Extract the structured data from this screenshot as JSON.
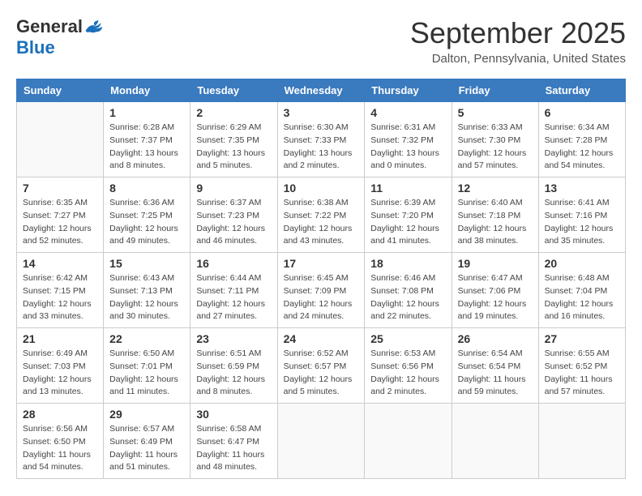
{
  "header": {
    "logo_general": "General",
    "logo_blue": "Blue",
    "month_title": "September 2025",
    "location": "Dalton, Pennsylvania, United States"
  },
  "weekdays": [
    "Sunday",
    "Monday",
    "Tuesday",
    "Wednesday",
    "Thursday",
    "Friday",
    "Saturday"
  ],
  "weeks": [
    [
      {
        "day": "",
        "info": ""
      },
      {
        "day": "1",
        "info": "Sunrise: 6:28 AM\nSunset: 7:37 PM\nDaylight: 13 hours\nand 8 minutes."
      },
      {
        "day": "2",
        "info": "Sunrise: 6:29 AM\nSunset: 7:35 PM\nDaylight: 13 hours\nand 5 minutes."
      },
      {
        "day": "3",
        "info": "Sunrise: 6:30 AM\nSunset: 7:33 PM\nDaylight: 13 hours\nand 2 minutes."
      },
      {
        "day": "4",
        "info": "Sunrise: 6:31 AM\nSunset: 7:32 PM\nDaylight: 13 hours\nand 0 minutes."
      },
      {
        "day": "5",
        "info": "Sunrise: 6:33 AM\nSunset: 7:30 PM\nDaylight: 12 hours\nand 57 minutes."
      },
      {
        "day": "6",
        "info": "Sunrise: 6:34 AM\nSunset: 7:28 PM\nDaylight: 12 hours\nand 54 minutes."
      }
    ],
    [
      {
        "day": "7",
        "info": "Sunrise: 6:35 AM\nSunset: 7:27 PM\nDaylight: 12 hours\nand 52 minutes."
      },
      {
        "day": "8",
        "info": "Sunrise: 6:36 AM\nSunset: 7:25 PM\nDaylight: 12 hours\nand 49 minutes."
      },
      {
        "day": "9",
        "info": "Sunrise: 6:37 AM\nSunset: 7:23 PM\nDaylight: 12 hours\nand 46 minutes."
      },
      {
        "day": "10",
        "info": "Sunrise: 6:38 AM\nSunset: 7:22 PM\nDaylight: 12 hours\nand 43 minutes."
      },
      {
        "day": "11",
        "info": "Sunrise: 6:39 AM\nSunset: 7:20 PM\nDaylight: 12 hours\nand 41 minutes."
      },
      {
        "day": "12",
        "info": "Sunrise: 6:40 AM\nSunset: 7:18 PM\nDaylight: 12 hours\nand 38 minutes."
      },
      {
        "day": "13",
        "info": "Sunrise: 6:41 AM\nSunset: 7:16 PM\nDaylight: 12 hours\nand 35 minutes."
      }
    ],
    [
      {
        "day": "14",
        "info": "Sunrise: 6:42 AM\nSunset: 7:15 PM\nDaylight: 12 hours\nand 33 minutes."
      },
      {
        "day": "15",
        "info": "Sunrise: 6:43 AM\nSunset: 7:13 PM\nDaylight: 12 hours\nand 30 minutes."
      },
      {
        "day": "16",
        "info": "Sunrise: 6:44 AM\nSunset: 7:11 PM\nDaylight: 12 hours\nand 27 minutes."
      },
      {
        "day": "17",
        "info": "Sunrise: 6:45 AM\nSunset: 7:09 PM\nDaylight: 12 hours\nand 24 minutes."
      },
      {
        "day": "18",
        "info": "Sunrise: 6:46 AM\nSunset: 7:08 PM\nDaylight: 12 hours\nand 22 minutes."
      },
      {
        "day": "19",
        "info": "Sunrise: 6:47 AM\nSunset: 7:06 PM\nDaylight: 12 hours\nand 19 minutes."
      },
      {
        "day": "20",
        "info": "Sunrise: 6:48 AM\nSunset: 7:04 PM\nDaylight: 12 hours\nand 16 minutes."
      }
    ],
    [
      {
        "day": "21",
        "info": "Sunrise: 6:49 AM\nSunset: 7:03 PM\nDaylight: 12 hours\nand 13 minutes."
      },
      {
        "day": "22",
        "info": "Sunrise: 6:50 AM\nSunset: 7:01 PM\nDaylight: 12 hours\nand 11 minutes."
      },
      {
        "day": "23",
        "info": "Sunrise: 6:51 AM\nSunset: 6:59 PM\nDaylight: 12 hours\nand 8 minutes."
      },
      {
        "day": "24",
        "info": "Sunrise: 6:52 AM\nSunset: 6:57 PM\nDaylight: 12 hours\nand 5 minutes."
      },
      {
        "day": "25",
        "info": "Sunrise: 6:53 AM\nSunset: 6:56 PM\nDaylight: 12 hours\nand 2 minutes."
      },
      {
        "day": "26",
        "info": "Sunrise: 6:54 AM\nSunset: 6:54 PM\nDaylight: 11 hours\nand 59 minutes."
      },
      {
        "day": "27",
        "info": "Sunrise: 6:55 AM\nSunset: 6:52 PM\nDaylight: 11 hours\nand 57 minutes."
      }
    ],
    [
      {
        "day": "28",
        "info": "Sunrise: 6:56 AM\nSunset: 6:50 PM\nDaylight: 11 hours\nand 54 minutes."
      },
      {
        "day": "29",
        "info": "Sunrise: 6:57 AM\nSunset: 6:49 PM\nDaylight: 11 hours\nand 51 minutes."
      },
      {
        "day": "30",
        "info": "Sunrise: 6:58 AM\nSunset: 6:47 PM\nDaylight: 11 hours\nand 48 minutes."
      },
      {
        "day": "",
        "info": ""
      },
      {
        "day": "",
        "info": ""
      },
      {
        "day": "",
        "info": ""
      },
      {
        "day": "",
        "info": ""
      }
    ]
  ]
}
